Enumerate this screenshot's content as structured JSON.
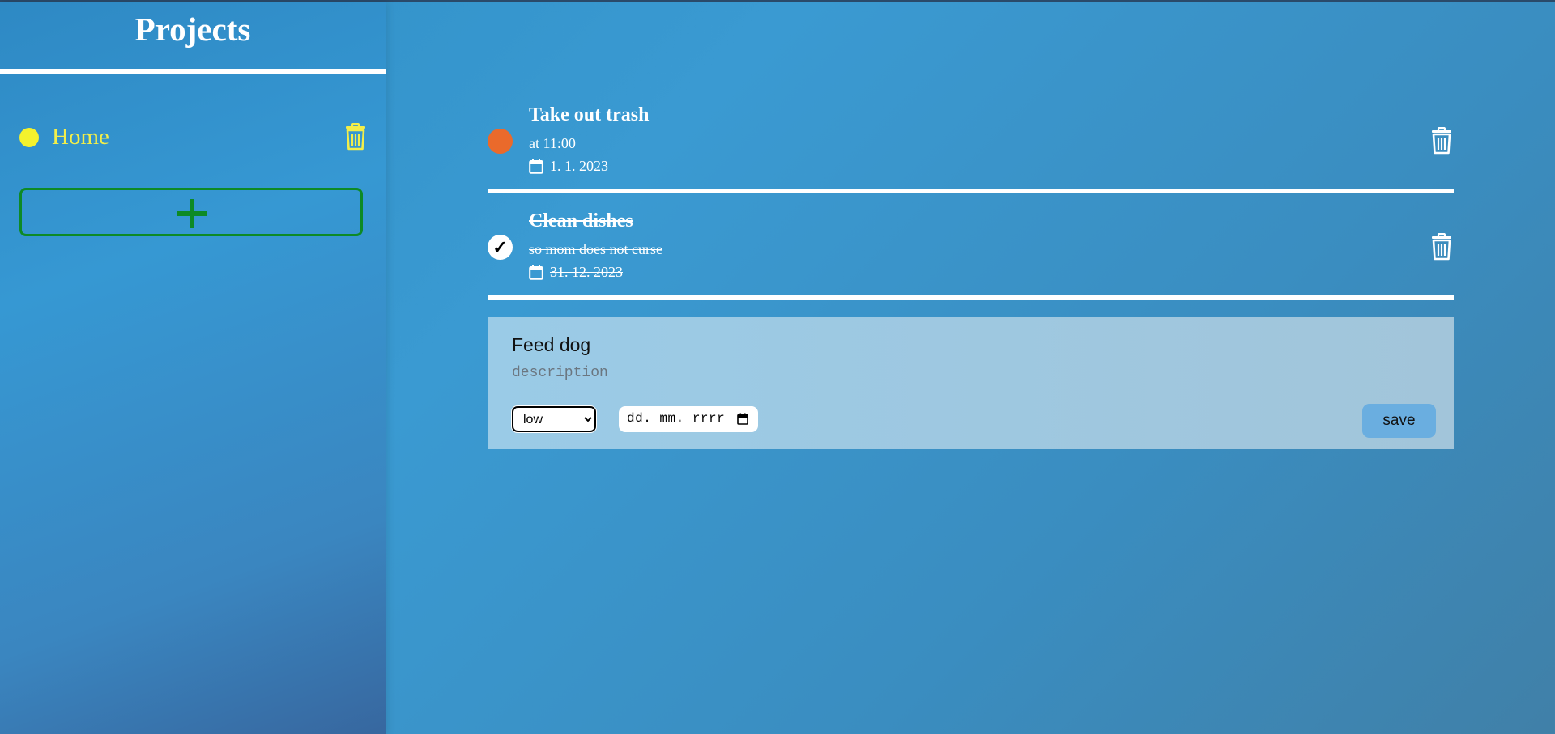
{
  "sidebar": {
    "title": "Projects",
    "projects": [
      {
        "label": "Home",
        "dot_color": "#f4f22c",
        "delete_icon": "trash-icon"
      }
    ],
    "add_icon": "plus-icon"
  },
  "tasks": [
    {
      "title": "Take out trash",
      "description": "at 11:00",
      "date": "1. 1. 2023",
      "status": "priority",
      "status_color": "#ea6a2b",
      "done": false,
      "date_icon": "calendar-icon",
      "delete_icon": "trash-icon"
    },
    {
      "title": "Clean dishes",
      "description": "so mom does not curse",
      "date": "31. 12. 2023",
      "status": "done",
      "check_mark": "✓",
      "done": true,
      "date_icon": "calendar-icon",
      "delete_icon": "trash-icon"
    }
  ],
  "new_task_form": {
    "title_value": "Feed dog",
    "description_placeholder": "description",
    "priority_selected": "low",
    "date_placeholder": "dd. mm. rrrr",
    "save_label": "save"
  },
  "colors": {
    "accent_yellow": "#f4f22c",
    "add_green": "#0d8a26",
    "priority_orange": "#ea6a2b",
    "save_button": "#6aaee0"
  }
}
